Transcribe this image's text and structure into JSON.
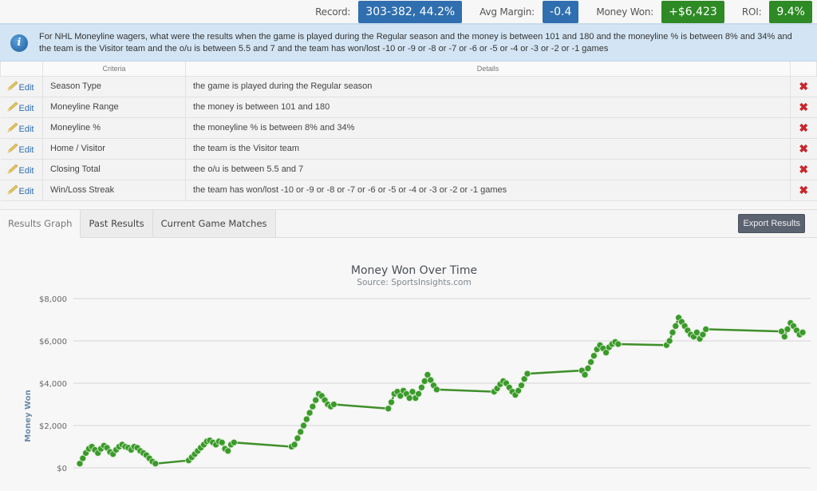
{
  "stats": [
    {
      "label": "Record:",
      "value": "303-382, 44.2%",
      "color": "blue"
    },
    {
      "label": "Avg Margin:",
      "value": "-0.4",
      "color": "blue"
    },
    {
      "label": "Money Won:",
      "value": "+$6,423",
      "color": "green"
    },
    {
      "label": "ROI:",
      "value": "9.4%",
      "color": "green"
    }
  ],
  "info": {
    "icon": "info-icon",
    "text": "For NHL Moneyline wagers, what were the results when the game is played during the Regular season and the money is between 101 and 180 and the moneyline % is between 8% and 34% and the team is the Visitor team and the o/u is between 5.5 and 7 and the team has won/lost -10 or -9 or -8 or -7 or -6 or -5 or -4 or -3 or -2 or -1 games"
  },
  "criteria_table": {
    "headers": [
      "",
      "Criteria",
      "Details",
      ""
    ],
    "edit_label": "Edit",
    "delete_icon": "✖",
    "rows": [
      {
        "criteria": "Season Type",
        "details": "the game is played during the Regular season"
      },
      {
        "criteria": "Moneyline Range",
        "details": "the money is between 101 and 180"
      },
      {
        "criteria": "Moneyline %",
        "details": "the moneyline % is between 8% and 34%"
      },
      {
        "criteria": "Home / Visitor",
        "details": "the team is the Visitor team"
      },
      {
        "criteria": "Closing Total",
        "details": "the o/u is between 5.5 and 7"
      },
      {
        "criteria": "Win/Loss Streak",
        "details": "the team has won/lost -10 or -9 or -8 or -7 or -6 or -5 or -4 or -3 or -2 or -1 games"
      }
    ]
  },
  "tabs": [
    {
      "label": "Results Graph",
      "active": true
    },
    {
      "label": "Past Results",
      "active": false
    },
    {
      "label": "Current Game Matches",
      "active": false
    }
  ],
  "export_label": "Export Results",
  "colors": {
    "line": "#3f8f2a",
    "marker": "#3a9a2a",
    "marker_stroke": "#d8ecd0",
    "grid": "#d6d6d6"
  },
  "chart_data": {
    "type": "line",
    "title": "Money Won Over Time",
    "subtitle": "Source: SportsInsights.com",
    "xlabel": "",
    "ylabel": "Money Won",
    "ylim": [
      0,
      8000
    ],
    "yticks": [
      0,
      2000,
      4000,
      6000,
      8000
    ],
    "ytick_labels": [
      "$0",
      "$2,000",
      "$4,000",
      "$6,000",
      "$8,000"
    ],
    "grid": true,
    "legend": "none",
    "note": "x is bet sequence index over time (no x-axis labels shown); values approximate cumulative money won",
    "series": [
      {
        "name": "Money Won",
        "points": [
          [
            0,
            200
          ],
          [
            1,
            450
          ],
          [
            2,
            700
          ],
          [
            3,
            900
          ],
          [
            4,
            1000
          ],
          [
            5,
            850
          ],
          [
            6,
            700
          ],
          [
            7,
            900
          ],
          [
            8,
            1050
          ],
          [
            9,
            950
          ],
          [
            10,
            750
          ],
          [
            11,
            650
          ],
          [
            12,
            850
          ],
          [
            13,
            1000
          ],
          [
            14,
            1100
          ],
          [
            15,
            1000
          ],
          [
            16,
            950
          ],
          [
            17,
            850
          ],
          [
            18,
            1000
          ],
          [
            19,
            950
          ],
          [
            20,
            800
          ],
          [
            21,
            700
          ],
          [
            22,
            600
          ],
          [
            23,
            450
          ],
          [
            24,
            300
          ],
          [
            25,
            200
          ],
          [
            36,
            350
          ],
          [
            37,
            500
          ],
          [
            38,
            650
          ],
          [
            39,
            800
          ],
          [
            40,
            950
          ],
          [
            41,
            1100
          ],
          [
            42,
            1250
          ],
          [
            43,
            1300
          ],
          [
            44,
            1200
          ],
          [
            45,
            1100
          ],
          [
            46,
            1250
          ],
          [
            47,
            1200
          ],
          [
            48,
            900
          ],
          [
            49,
            800
          ],
          [
            50,
            1100
          ],
          [
            51,
            1200
          ],
          [
            70,
            1000
          ],
          [
            71,
            1100
          ],
          [
            72,
            1400
          ],
          [
            73,
            1700
          ],
          [
            74,
            2000
          ],
          [
            75,
            2300
          ],
          [
            76,
            2600
          ],
          [
            77,
            2900
          ],
          [
            78,
            3200
          ],
          [
            79,
            3500
          ],
          [
            80,
            3400
          ],
          [
            81,
            3200
          ],
          [
            82,
            3000
          ],
          [
            83,
            2900
          ],
          [
            84,
            3000
          ],
          [
            102,
            2800
          ],
          [
            103,
            3100
          ],
          [
            104,
            3500
          ],
          [
            105,
            3600
          ],
          [
            106,
            3400
          ],
          [
            107,
            3650
          ],
          [
            108,
            3500
          ],
          [
            109,
            3300
          ],
          [
            110,
            3600
          ],
          [
            111,
            3300
          ],
          [
            112,
            3500
          ],
          [
            113,
            3800
          ],
          [
            114,
            4100
          ],
          [
            115,
            4400
          ],
          [
            116,
            4150
          ],
          [
            117,
            3900
          ],
          [
            118,
            3700
          ],
          [
            137,
            3600
          ],
          [
            138,
            3750
          ],
          [
            139,
            3950
          ],
          [
            140,
            4100
          ],
          [
            141,
            4000
          ],
          [
            142,
            3800
          ],
          [
            143,
            3600
          ],
          [
            144,
            3450
          ],
          [
            145,
            3650
          ],
          [
            146,
            3900
          ],
          [
            147,
            4200
          ],
          [
            148,
            4450
          ],
          [
            166,
            4600
          ],
          [
            167,
            4400
          ],
          [
            168,
            4700
          ],
          [
            169,
            5000
          ],
          [
            170,
            5300
          ],
          [
            171,
            5600
          ],
          [
            172,
            5800
          ],
          [
            173,
            5650
          ],
          [
            174,
            5450
          ],
          [
            175,
            5700
          ],
          [
            176,
            5850
          ],
          [
            177,
            5950
          ],
          [
            178,
            5850
          ],
          [
            194,
            5800
          ],
          [
            195,
            6000
          ],
          [
            196,
            6400
          ],
          [
            197,
            6700
          ],
          [
            198,
            7100
          ],
          [
            199,
            6900
          ],
          [
            200,
            6700
          ],
          [
            201,
            6500
          ],
          [
            202,
            6300
          ],
          [
            203,
            6200
          ],
          [
            204,
            6400
          ],
          [
            205,
            6100
          ],
          [
            206,
            6300
          ],
          [
            207,
            6550
          ],
          [
            232,
            6450
          ],
          [
            233,
            6200
          ],
          [
            234,
            6550
          ],
          [
            235,
            6850
          ],
          [
            236,
            6700
          ],
          [
            237,
            6500
          ],
          [
            238,
            6300
          ],
          [
            239,
            6400
          ]
        ]
      }
    ]
  }
}
